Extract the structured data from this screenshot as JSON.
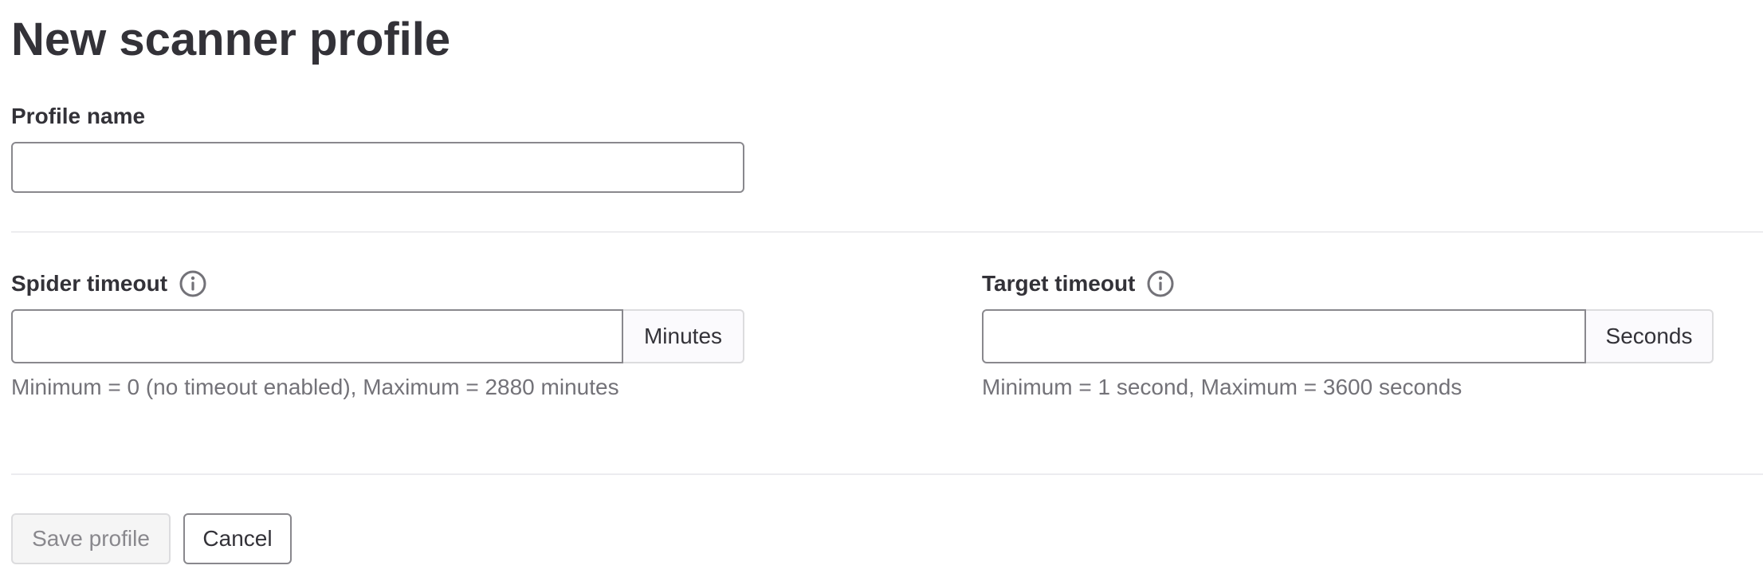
{
  "page": {
    "title": "New scanner profile"
  },
  "profile_name": {
    "label": "Profile name",
    "value": "",
    "placeholder": ""
  },
  "spider_timeout": {
    "label": "Spider timeout",
    "value": "",
    "unit": "Minutes",
    "help": "Minimum = 0 (no timeout enabled), Maximum = 2880 minutes",
    "icon": "info-icon"
  },
  "target_timeout": {
    "label": "Target timeout",
    "value": "",
    "unit": "Seconds",
    "help": "Minimum = 1 second, Maximum = 3600 seconds",
    "icon": "info-icon"
  },
  "actions": {
    "save_label": "Save profile",
    "save_disabled": true,
    "cancel_label": "Cancel"
  },
  "colors": {
    "text": "#333238",
    "muted": "#737278",
    "border": "#89888d",
    "divider": "#ececef",
    "addon_bg": "#fbfafd"
  }
}
